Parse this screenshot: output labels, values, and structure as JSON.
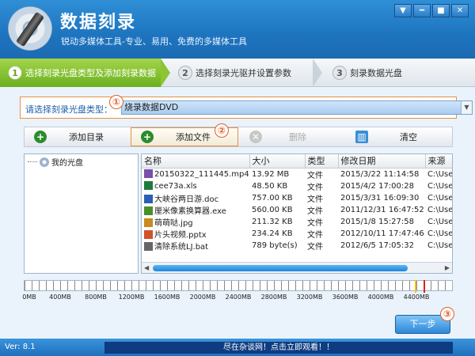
{
  "app": {
    "title": "数据刻录",
    "subtitle": "锐动多媒体工具-专业、易用、免费的多媒体工具"
  },
  "window_controls": [
    "▼",
    "━",
    "■",
    "✕"
  ],
  "steps": [
    {
      "num": "1",
      "label": "选择刻录光盘类型及添加刻录数据",
      "active": true
    },
    {
      "num": "2",
      "label": "选择刻录光驱并设置参数",
      "active": false
    },
    {
      "num": "3",
      "label": "刻录数据光盘",
      "active": false
    }
  ],
  "disc": {
    "label": "请选择刻录光盘类型：",
    "selected": "烧录数据DVD"
  },
  "badges": [
    "①",
    "②",
    "③"
  ],
  "toolbar": {
    "add_folder": "添加目录",
    "add_file": "添加文件",
    "delete": "删除",
    "clear": "清空"
  },
  "tree": {
    "root": "我的光盘"
  },
  "files": {
    "columns": [
      "名称",
      "大小",
      "类型",
      "修改日期",
      "来源"
    ],
    "rows": [
      {
        "name": "20150322_111445.mp4",
        "size": "13.92 MB",
        "type": "文件",
        "date": "2015/3/22 11:14:58",
        "source": "C:\\Use",
        "icon": "video-file-icon"
      },
      {
        "name": "cee73a.xls",
        "size": "48.50 KB",
        "type": "文件",
        "date": "2015/4/2 17:00:28",
        "source": "C:\\Use",
        "icon": "excel-file-icon"
      },
      {
        "name": "大峡谷两日游.doc",
        "size": "757.00 KB",
        "type": "文件",
        "date": "2015/3/31 16:09:30",
        "source": "C:\\Use",
        "icon": "word-file-icon"
      },
      {
        "name": "厘米像素换算器.exe",
        "size": "560.00 KB",
        "type": "文件",
        "date": "2011/12/31 16:47:52",
        "source": "C:\\Use",
        "icon": "exe-file-icon"
      },
      {
        "name": "萌萌哒.jpg",
        "size": "211.32 KB",
        "type": "文件",
        "date": "2015/1/8 15:27:58",
        "source": "C:\\Use",
        "icon": "image-file-icon"
      },
      {
        "name": "片头视频.pptx",
        "size": "234.24 KB",
        "type": "文件",
        "date": "2012/10/11 17:47:46",
        "source": "C:\\Use",
        "icon": "ppt-file-icon"
      },
      {
        "name": "清除系统LJ.bat",
        "size": "789 byte(s)",
        "type": "文件",
        "date": "2012/6/5 17:05:32",
        "source": "C:\\Use",
        "icon": "bat-file-icon"
      }
    ]
  },
  "ruler": {
    "ticks": [
      "0MB",
      "400MB",
      "800MB",
      "1200MB",
      "1600MB",
      "2000MB",
      "2400MB",
      "2800MB",
      "3200MB",
      "3600MB",
      "4000MB",
      "4400MB"
    ],
    "max_mb": 4800,
    "markers_mb": [
      {
        "value": 4380,
        "color": "#f2c200"
      },
      {
        "value": 4480,
        "color": "#d9241c"
      }
    ]
  },
  "next_button": "下一步",
  "status": {
    "version": "Ver: 8.1",
    "ad": "尽在杂谈网！点击立即观看！！"
  },
  "colors": {
    "title_bar": "#1e74bf",
    "active_step": "#6bb01f",
    "highlight_border": "#e59043"
  }
}
